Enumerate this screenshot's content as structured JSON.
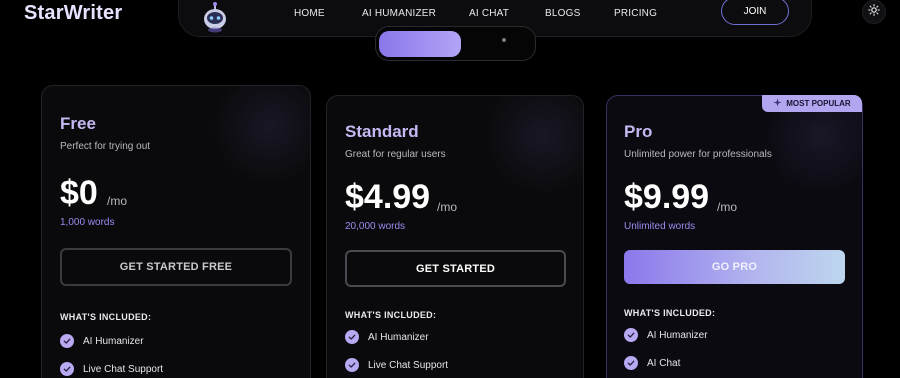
{
  "brand": {
    "name": "StarWriter"
  },
  "nav": {
    "links": [
      "HOME",
      "AI HUMANIZER",
      "AI CHAT",
      "BLOGS",
      "PRICING"
    ],
    "join_label": "JOIN"
  },
  "icons": {
    "robot": "robot-mascot-icon",
    "theme": "sun-icon",
    "check": "check-icon",
    "sparkle": "sparkle-icon"
  },
  "colors": {
    "accent": "#9b8cf0",
    "badge": "#b3a6f1",
    "check": "#b9a8f2"
  },
  "plans": [
    {
      "name": "Free",
      "description": "Perfect for trying out",
      "price": "$0",
      "period": "/mo",
      "words": "1,000 words",
      "cta": "GET STARTED FREE",
      "included_label": "WHAT'S INCLUDED:",
      "features": [
        "AI Humanizer",
        "Live Chat Support"
      ]
    },
    {
      "name": "Standard",
      "description": "Great for regular users",
      "price": "$4.99",
      "period": "/mo",
      "words": "20,000 words",
      "cta": "GET STARTED",
      "included_label": "WHAT'S INCLUDED:",
      "features": [
        "AI Humanizer",
        "Live Chat Support"
      ]
    },
    {
      "name": "Pro",
      "description": "Unlimited power for professionals",
      "price": "$9.99",
      "period": "/mo",
      "words": "Unlimited words",
      "cta": "GO PRO",
      "included_label": "WHAT'S INCLUDED:",
      "features": [
        "AI Humanizer",
        "AI Chat"
      ],
      "badge": "MOST POPULAR"
    }
  ]
}
